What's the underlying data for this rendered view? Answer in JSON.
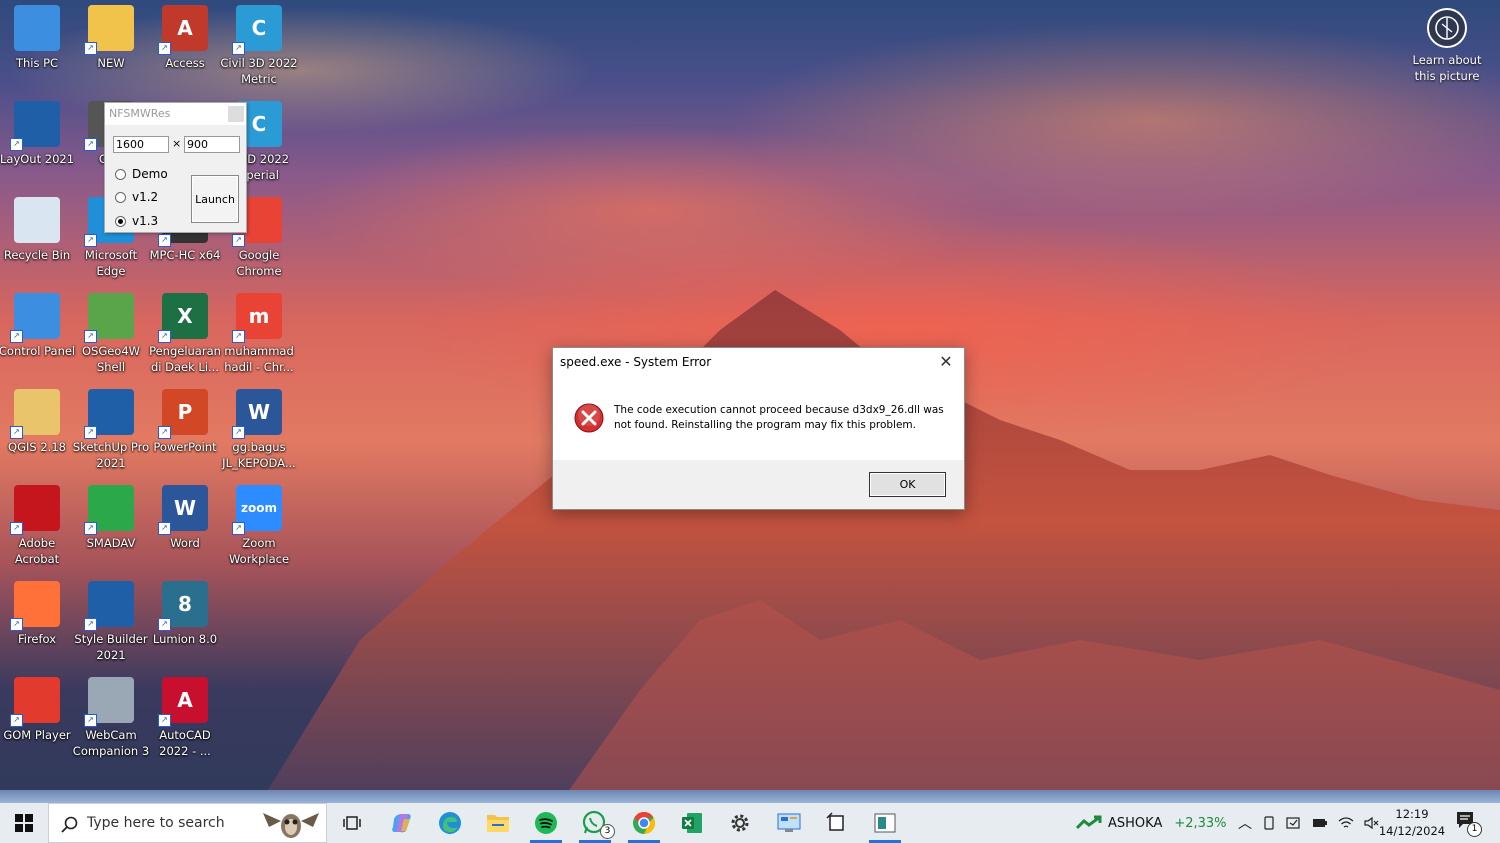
{
  "desktop_icons": [
    {
      "label": "This PC",
      "icon": "this-pc-icon",
      "color": "#3b8ee0"
    },
    {
      "label": "NEW",
      "icon": "folder-icon",
      "color": "#f2c34b"
    },
    {
      "label": "Access",
      "icon": "access-icon",
      "color": "#c0392b",
      "glyph": "A"
    },
    {
      "label": "Civil 3D 2022\nMetric",
      "icon": "civil3d-icon",
      "color": "#2b9bd6",
      "glyph": "C"
    },
    {
      "label": "LayOut 2021",
      "icon": "layout-icon",
      "color": "#1e5fa8"
    },
    {
      "label": "GRA\n7",
      "icon": "graphics-icon",
      "color": "#555"
    },
    {
      "label": "1 3D 2022\nnperial",
      "icon": "civil3d-imperial-icon",
      "color": "#2b9bd6",
      "glyph": "C"
    },
    {
      "label": "Recycle Bin",
      "icon": "recycle-bin-icon",
      "color": "#d9e6f2"
    },
    {
      "label": "Microsoft\nEdge",
      "icon": "edge-icon",
      "color": "#1f8fd8"
    },
    {
      "label": "MPC-HC x64",
      "icon": "mpc-icon",
      "color": "#333"
    },
    {
      "label": "Google\nChrome",
      "icon": "chrome-icon",
      "color": "#e84335"
    },
    {
      "label": "Control Panel",
      "icon": "control-panel-icon",
      "color": "#3b8ee0"
    },
    {
      "label": "OSGeo4W\nShell",
      "icon": "osgeo-icon",
      "color": "#5aa44a"
    },
    {
      "label": "Pengeluaran\ndi Daek Li...",
      "icon": "excel-file-icon",
      "color": "#1d7044",
      "glyph": "X"
    },
    {
      "label": "muhammad\nhadil - Chr...",
      "icon": "chrome-profile-icon",
      "color": "#e84335",
      "glyph": "m"
    },
    {
      "label": "QGIS 2.18",
      "icon": "qgis-icon",
      "color": "#e9c46a"
    },
    {
      "label": "SketchUp Pro\n2021",
      "icon": "sketchup-icon",
      "color": "#1e5fa8"
    },
    {
      "label": "PowerPoint",
      "icon": "powerpoint-icon",
      "color": "#d24726",
      "glyph": "P"
    },
    {
      "label": "gg.bagus\nJL_KEPODA...",
      "icon": "word-file-icon",
      "color": "#2b579a",
      "glyph": "W"
    },
    {
      "label": "Adobe\nAcrobat",
      "icon": "acrobat-icon",
      "color": "#c4161c"
    },
    {
      "label": "SMADAV",
      "icon": "smadav-icon",
      "color": "#2aa84a"
    },
    {
      "label": "Word",
      "icon": "word-icon",
      "color": "#2b579a",
      "glyph": "W"
    },
    {
      "label": "Zoom\nWorkplace",
      "icon": "zoom-icon",
      "color": "#2d8cff",
      "glyph": "zoom"
    },
    {
      "label": "Firefox",
      "icon": "firefox-icon",
      "color": "#ff7139"
    },
    {
      "label": "Style Builder\n2021",
      "icon": "style-builder-icon",
      "color": "#1e5fa8"
    },
    {
      "label": "Lumion 8.0",
      "icon": "lumion-icon",
      "color": "#2b6f8f",
      "glyph": "8"
    },
    {
      "label": "GOM Player",
      "icon": "gom-player-icon",
      "color": "#e23b2e"
    },
    {
      "label": "WebCam\nCompanion 3",
      "icon": "webcam-icon",
      "color": "#9aa7b5"
    },
    {
      "label": "AutoCAD\n2022 - ...",
      "icon": "autocad-icon",
      "color": "#c8102e",
      "glyph": "A"
    }
  ],
  "nfs_window": {
    "title": "NFSMWRes",
    "width_value": "1600",
    "x_sep": "×",
    "height_value": "900",
    "options": [
      "Demo",
      "v1.2",
      "v1.3"
    ],
    "selected": "v1.3",
    "launch_label": "Launch"
  },
  "dialog": {
    "title": "speed.exe - System Error",
    "message": "The code execution cannot proceed because d3dx9_26.dll was not found. Reinstalling the program may fix this problem.",
    "ok_label": "OK",
    "close_glyph": "✕"
  },
  "learn_picture": {
    "label": "Learn about\nthis picture"
  },
  "taskbar": {
    "search_placeholder": "Type here to search",
    "apps": [
      "task-view",
      "copilot",
      "edge",
      "file-explorer",
      "spotify",
      "whatsapp",
      "chrome",
      "excel",
      "settings",
      "control-panel",
      "snipping",
      "nfs-launcher"
    ],
    "whatsapp_badge": "3",
    "stock_name": "ASHOKA",
    "stock_change": "+2,33%",
    "stock_color": "#1e8a3c",
    "time": "12:19",
    "date": "14/12/2024",
    "notification_count": "1"
  }
}
